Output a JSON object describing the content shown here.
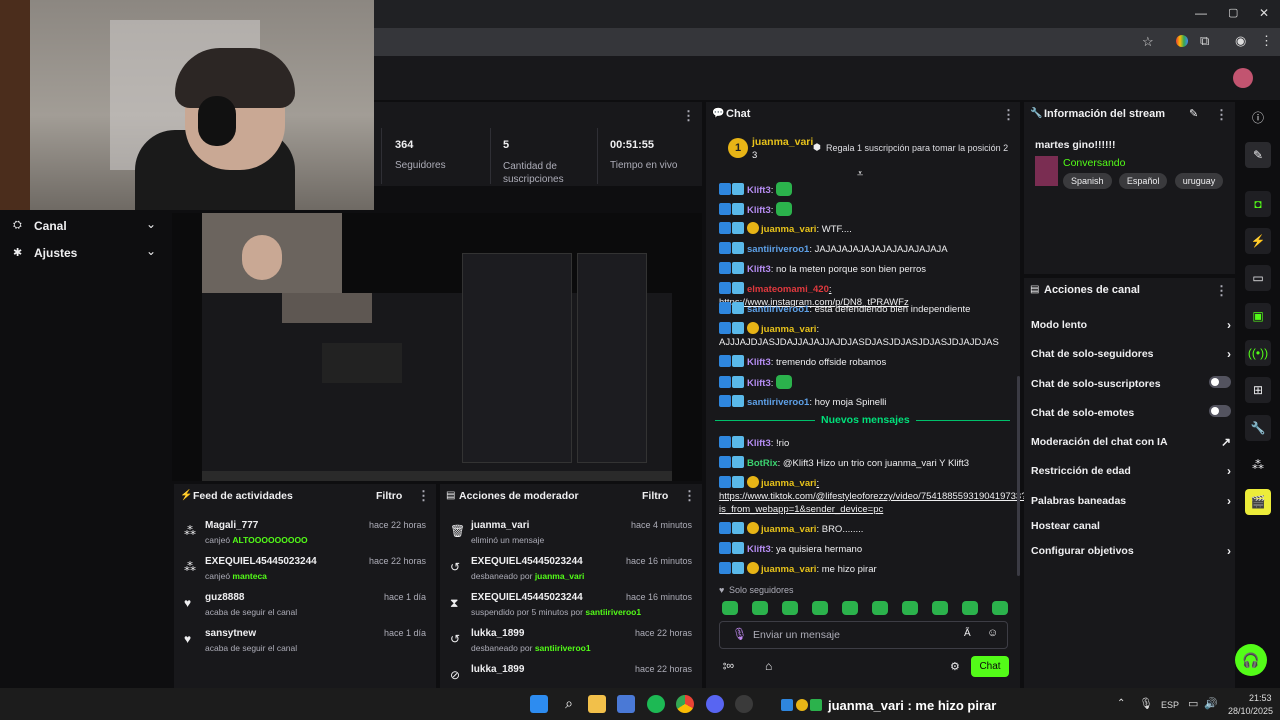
{
  "window": {
    "minimize": "—",
    "maximize": "▢",
    "close": "✕"
  },
  "stats": [
    {
      "value": "364",
      "label": "Seguidores"
    },
    {
      "value": "5",
      "label": "Cantidad de suscripciones"
    },
    {
      "value": "00:51:55",
      "label": "Tiempo en vivo"
    }
  ],
  "sidebar": {
    "items": [
      {
        "label": "Canal",
        "icon": "canal-icon"
      },
      {
        "label": "Ajustes",
        "icon": "gear-icon"
      }
    ]
  },
  "chat": {
    "title": "Chat",
    "pinned": {
      "user": "juanma_vari",
      "count": "3",
      "gift_text": "Regala 1 suscripción para tomar la posición 2"
    },
    "messages": [
      {
        "user": "Klift3",
        "text": ":",
        "cls": "u-purple",
        "emote": true
      },
      {
        "user": "Klift3",
        "text": ":",
        "cls": "u-purple",
        "emote": true
      },
      {
        "user": "juanma_vari",
        "text": ": WTF....",
        "cls": "u-yellow"
      },
      {
        "user": "santiiriveroo1",
        "text": ": JAJAJAJAJAJAJAJAJAJAJAJA",
        "cls": "u-blue"
      },
      {
        "user": "Klift3",
        "text": ": no la meten porque son bien perros",
        "cls": "u-purple"
      },
      {
        "user": "elmateomami_420",
        "text": ": https://www.instagram.com/p/DN8_tPRAWFz",
        "cls": "u-red"
      },
      {
        "user": "santiiriveroo1",
        "text": ": está defendiendo bien independiente",
        "cls": "u-blue"
      },
      {
        "user": "juanma_vari",
        "text": ": AJJJAJDJASJDAJJAJAJJAJDJASDJASJDJASJDJASJDJAJDJAS",
        "cls": "u-yellow"
      },
      {
        "user": "Klift3",
        "text": ": tremendo offside robamos",
        "cls": "u-purple"
      },
      {
        "user": "Klift3",
        "text": ":",
        "cls": "u-purple",
        "emote": true
      },
      {
        "user": "santiiriveroo1",
        "text": ": hoy moja Spinelli",
        "cls": "u-blue"
      }
    ],
    "new_messages_label": "Nuevos mensajes",
    "new_messages": [
      {
        "user": "Klift3",
        "text": ": !rio",
        "cls": "u-purple"
      },
      {
        "user": "BotRix",
        "text": ": @Klift3 Hizo un trio con juanma_vari Y Klift3",
        "cls": "u-green"
      },
      {
        "user": "juanma_vari",
        "text": ": https://www.tiktok.com/@lifestyleoforezzy/video/7541885593190419733?is_from_webapp=1&sender_device=pc",
        "cls": "u-yellow"
      },
      {
        "user": "juanma_vari",
        "text": ": BRO........",
        "cls": "u-yellow"
      },
      {
        "user": "Klift3",
        "text": ": ya quisiera hermano",
        "cls": "u-purple"
      },
      {
        "user": "juanma_vari",
        "text": ": me hizo pirar",
        "cls": "u-yellow"
      }
    ],
    "followers_only": "Solo seguidores",
    "input_placeholder": "Enviar un mensaje",
    "send_label": "Chat"
  },
  "stream_info": {
    "title": "Información del stream",
    "stream_title": "martes gino!!!!!!",
    "category": "Conversando",
    "tags": [
      "Spanish",
      "Español",
      "uruguay"
    ]
  },
  "channel_actions": {
    "title": "Acciones de canal",
    "items": [
      {
        "label": "Modo lento",
        "kind": "chevron"
      },
      {
        "label": "Chat de solo-seguidores",
        "kind": "chevron"
      },
      {
        "label": "Chat de solo-suscriptores",
        "kind": "toggle"
      },
      {
        "label": "Chat de solo-emotes",
        "kind": "toggle"
      },
      {
        "label": "Moderación del chat con IA",
        "kind": "external"
      },
      {
        "label": "Restricción de edad",
        "kind": "chevron"
      },
      {
        "label": "Palabras baneadas",
        "kind": "chevron"
      },
      {
        "label": "Hostear canal",
        "kind": "none"
      },
      {
        "label": "Configurar objetivos",
        "kind": "chevron"
      }
    ]
  },
  "activity_feed": {
    "title": "Feed de actividades",
    "filter": "Filtro",
    "items": [
      {
        "name": "Magali_777",
        "sub_prefix": "canjeó",
        "sub_highlight": "ALTOOOOOOOOO",
        "time": "hace 22 horas"
      },
      {
        "name": "EXEQUIEL45445023244",
        "sub_prefix": "canjeó",
        "sub_highlight": "manteca",
        "time": "hace 22 horas"
      },
      {
        "name": "guz8888",
        "sub_prefix": "acaba de seguir el canal",
        "sub_highlight": "",
        "time": "hace 1 día"
      },
      {
        "name": "sansytnew",
        "sub_prefix": "acaba de seguir el canal",
        "sub_highlight": "",
        "time": "hace 1 día"
      }
    ]
  },
  "mod_actions": {
    "title": "Acciones de moderador",
    "filter": "Filtro",
    "items": [
      {
        "name": "juanma_vari",
        "sub_prefix": "eliminó un mensaje",
        "sub_highlight": "",
        "time": "hace 4 minutos"
      },
      {
        "name": "EXEQUIEL45445023244",
        "sub_prefix": "desbaneado por",
        "sub_highlight": "juanma_vari",
        "time": "hace 16 minutos"
      },
      {
        "name": "EXEQUIEL45445023244",
        "sub_prefix": "suspendido por 5 minutos por",
        "sub_highlight": "santiiriveroo1",
        "time": "hace 16 minutos"
      },
      {
        "name": "lukka_1899",
        "sub_prefix": "desbaneado por",
        "sub_highlight": "santiiriveroo1",
        "time": "hace 22 horas"
      },
      {
        "name": "lukka_1899",
        "sub_prefix": "",
        "sub_highlight": "",
        "time": "hace 22 horas"
      }
    ]
  },
  "taskbar": {
    "now_playing": "juanma_vari : me hizo pirar",
    "lang": "ESP",
    "time": "21:53",
    "date": "28/10/2025"
  }
}
